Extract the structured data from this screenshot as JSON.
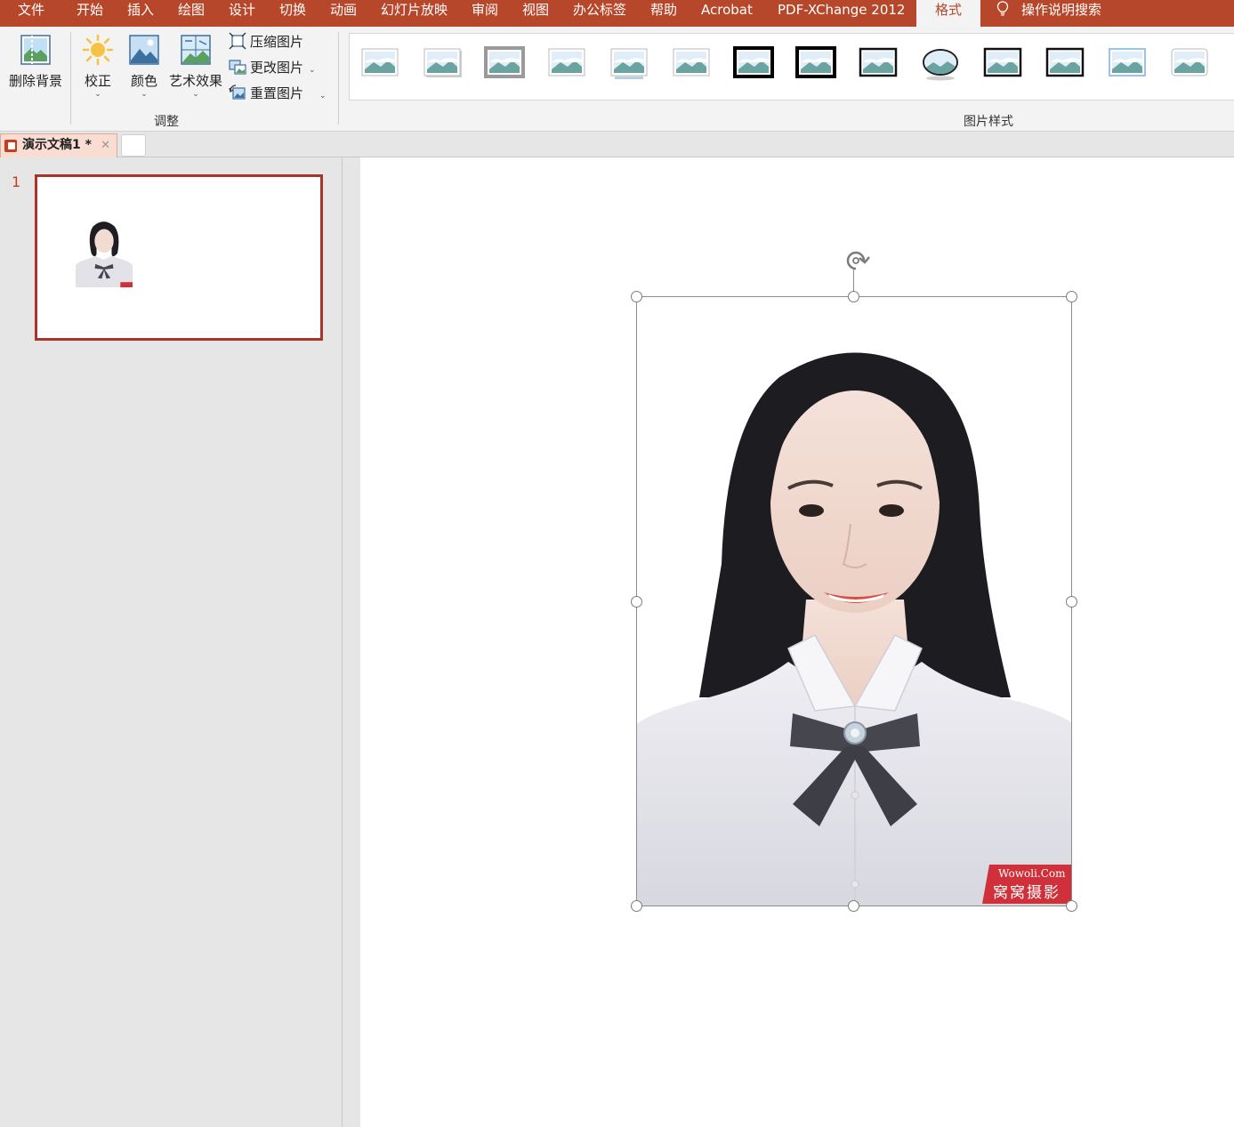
{
  "menu": {
    "tabs": [
      "文件",
      "开始",
      "插入",
      "绘图",
      "设计",
      "切换",
      "动画",
      "幻灯片放映",
      "审阅",
      "视图",
      "办公标签",
      "帮助",
      "Acrobat",
      "PDF-XChange 2012",
      "格式"
    ],
    "active_tab": "格式",
    "search_label": "操作说明搜索"
  },
  "ribbon": {
    "remove_bg": "删除背景",
    "corrections": "校正",
    "color": "颜色",
    "artistic": "艺术效果",
    "compress": "压缩图片",
    "change": "更改图片",
    "reset": "重置图片",
    "group_adjust": "调整",
    "group_styles": "图片样式",
    "style_count": 14
  },
  "document": {
    "tab_title": "演示文稿1 *",
    "tab_close": "✕"
  },
  "slides": {
    "current_number": "1"
  },
  "watermark": {
    "en": "Wowoli.Com",
    "cn": "窝窝摄影"
  },
  "colors": {
    "accent": "#b7472a",
    "selection_border": "#a9352a",
    "watermark_bg": "#d0303a"
  }
}
